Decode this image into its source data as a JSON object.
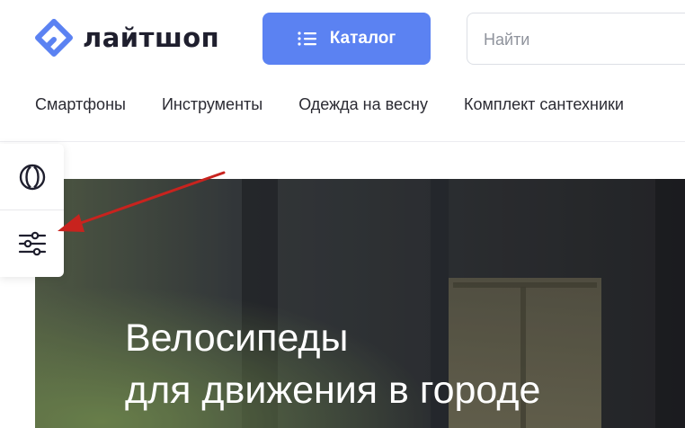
{
  "header": {
    "logo_text": "лайтшоп",
    "catalog_label": "Каталог",
    "search_placeholder": "Найти"
  },
  "nav": {
    "items": [
      {
        "label": "Смартфоны"
      },
      {
        "label": "Инструменты"
      },
      {
        "label": "Одежда на весну"
      },
      {
        "label": "Комплект сантехники"
      }
    ]
  },
  "side_panel": {
    "buttons": [
      {
        "icon": "compare-circles-icon"
      },
      {
        "icon": "filter-sliders-icon"
      }
    ]
  },
  "hero": {
    "title_line1": "Велосипеды",
    "title_line2": "для движения в городе"
  },
  "colors": {
    "brand_blue": "#5b82f2",
    "annotation_red": "#c8231e"
  }
}
